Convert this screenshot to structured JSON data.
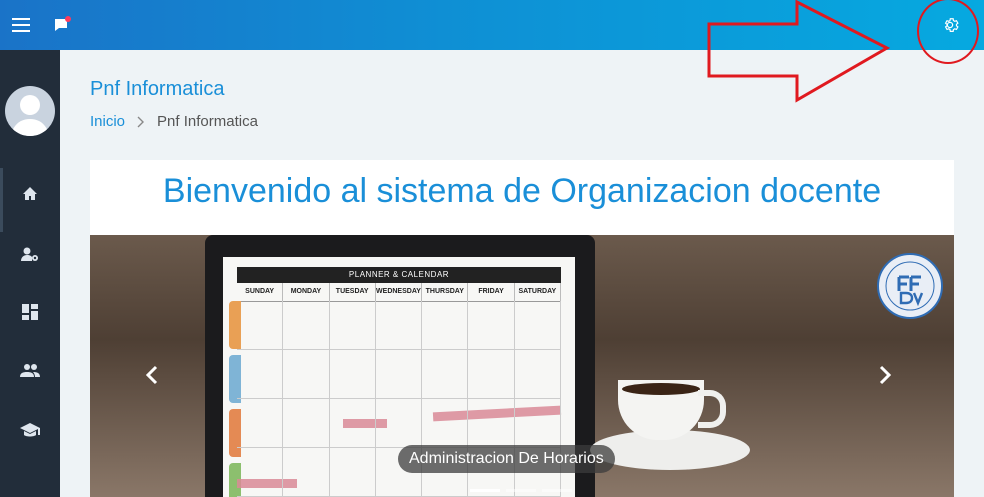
{
  "topbar": {
    "menu_icon": "hamburger-menu-icon",
    "chat_icon": "chat-notification-icon",
    "settings_icon": "gear-icon"
  },
  "sidebar": {
    "items": [
      {
        "icon": "home-icon"
      },
      {
        "icon": "user-settings-icon"
      },
      {
        "icon": "dashboard-icon"
      },
      {
        "icon": "group-icon"
      },
      {
        "icon": "graduation-cap-icon"
      }
    ]
  },
  "page": {
    "title": "Pnf Informatica",
    "breadcrumb": {
      "home": "Inicio",
      "current": "Pnf Informatica"
    }
  },
  "card": {
    "welcome": "Bienvenido al sistema de Organizacion docente"
  },
  "carousel": {
    "caption": "Administracion De Horarios",
    "slide_count": 3,
    "active_slide": 1
  },
  "planner": {
    "header": "PLANNER & CALENDAR",
    "days": [
      "SUNDAY",
      "MONDAY",
      "TUESDAY",
      "WEDNESDAY",
      "THURSDAY",
      "FRIDAY",
      "SATURDAY"
    ]
  },
  "colors": {
    "accent": "#1a8fd8",
    "sidebar": "#222d3a",
    "annotation": "#e0191f"
  }
}
